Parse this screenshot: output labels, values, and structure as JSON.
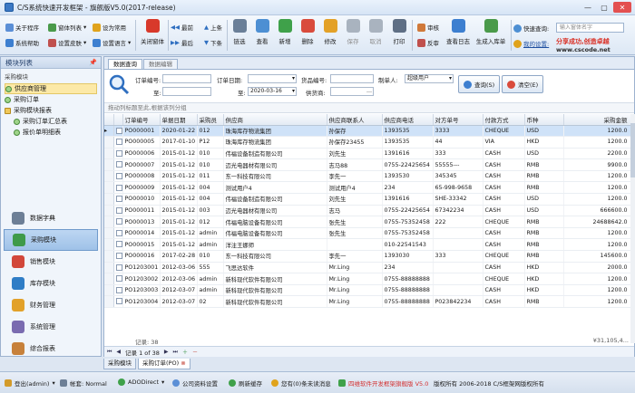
{
  "window": {
    "title": "C/S系统快速开发框架 - 旗舰版V5.0(2017-release)",
    "minimize": "—",
    "maximize": "▢",
    "close": "✕"
  },
  "toolbar": {
    "small_buttons": [
      {
        "label": "关于程序",
        "color": "#5b8fd6"
      },
      {
        "label": "窗体列表",
        "color": "#4a9a4a"
      },
      {
        "label": "设为常用",
        "color": "#e0a31c"
      },
      {
        "label": "系统帮助",
        "color": "#3d7fd0"
      },
      {
        "label": "设置皮肤",
        "color": "#c0504d"
      },
      {
        "label": "设置语言",
        "color": "#3d7fd0"
      }
    ],
    "close_window": "关闭窗体",
    "nav": [
      {
        "label": "最前",
        "arrow": "◀◀"
      },
      {
        "label": "上条",
        "arrow": "▲"
      },
      {
        "label": "最后",
        "arrow": "▶▶"
      },
      {
        "label": "下条",
        "arrow": "▼"
      }
    ],
    "big_buttons": [
      {
        "label": "链选",
        "color": "#6a7f98",
        "enabled": true
      },
      {
        "label": "查看",
        "color": "#4d8fd3",
        "enabled": true
      },
      {
        "label": "新增",
        "color": "#3fa14a",
        "enabled": true
      },
      {
        "label": "删除",
        "color": "#d94b3c",
        "enabled": true
      },
      {
        "label": "修改",
        "color": "#e3a127",
        "enabled": true
      },
      {
        "label": "保存",
        "color": "#a9b3bf",
        "enabled": false
      },
      {
        "label": "取消",
        "color": "#a9b3bf",
        "enabled": false
      },
      {
        "label": "打印",
        "color": "#5f6f85",
        "enabled": true
      },
      {
        "label": "审核",
        "color": "#d0793a",
        "enabled": true
      },
      {
        "label": "反审",
        "color": "#c0504d",
        "enabled": true
      },
      {
        "label": "查看日志",
        "color": "#3d7fd0",
        "enabled": true
      },
      {
        "label": "生成入库单",
        "color": "#4a9a4a",
        "enabled": true
      }
    ],
    "quick_search_label": "快速查询:",
    "search_placeholder": "输入窗体名字",
    "my_settings": "我的设置:",
    "slogan": "分享成功,创造卓越",
    "site": "www.cscode.net"
  },
  "left_panel": {
    "header": "模块列表",
    "pin": "📌",
    "category": "采购模块",
    "nodes": [
      {
        "label": "供应商管理",
        "selected": true,
        "child": false
      },
      {
        "label": "采购订单",
        "selected": false,
        "child": false
      },
      {
        "label": "采购模块报表",
        "selected": false,
        "child": false
      },
      {
        "label": "采购订单汇总表",
        "selected": false,
        "child": true
      },
      {
        "label": "报价单明细表",
        "selected": false,
        "child": true
      }
    ],
    "modules": [
      {
        "label": "数据字典",
        "color": "#6d7f96",
        "selected": false
      },
      {
        "label": "采购模块",
        "color": "#3e9a4a",
        "selected": true
      },
      {
        "label": "销售模块",
        "color": "#d2473a",
        "selected": false
      },
      {
        "label": "库存模块",
        "color": "#2f7dc6",
        "selected": false
      },
      {
        "label": "财务管理",
        "color": "#e2a12a",
        "selected": false
      },
      {
        "label": "系统管理",
        "color": "#7a6bb0",
        "selected": false
      },
      {
        "label": "综合报表",
        "color": "#c7813b",
        "selected": false
      }
    ]
  },
  "main": {
    "tabs": [
      {
        "label": "数据查询",
        "active": true
      },
      {
        "label": "数据编辑",
        "active": false
      }
    ],
    "query": {
      "order_no_label": "订单编号:",
      "order_date_label": "订单日期:",
      "to_label": "至:",
      "date_to": "2020-03-16",
      "goods_no_label": "货品编号:",
      "supplier_no_label": "供货商:",
      "maker_label": "制单人:",
      "maker_value": "超级用户",
      "query_button": "查询(S)",
      "clear_button": "清空(E)"
    },
    "group_hint": "拖动列标题至此,根据该列分组",
    "columns": [
      "订单编号",
      "单据日期",
      "采购员",
      "供应商",
      "供应商联系人",
      "供应商电话",
      "对方单号",
      "付款方式",
      "币种",
      "采购金额"
    ],
    "rows": [
      [
        "PO000001",
        "2020-01-22",
        "012",
        "珠海库存物流集团",
        "孙保存",
        "1393535",
        "3333",
        "CHEQUE",
        "USD",
        "1200.0"
      ],
      [
        "PO000005",
        "2017-01-10",
        "P12",
        "珠海库存物流集团",
        "孙保存23455",
        "1393535",
        "44",
        "VIA",
        "HKD",
        "1200.0"
      ],
      [
        "PO000006",
        "2015-01-12",
        "010",
        "伟福设备制造有限公司",
        "刘先生",
        "1391616",
        "333",
        "CASH",
        "USD",
        "2200.0"
      ],
      [
        "PO000007",
        "2015-01-12",
        "010",
        "迈光电器材有限公司",
        "志马88",
        "0755-22425654",
        "55555---",
        "CASH",
        "RMB",
        "9900.0"
      ],
      [
        "PO000008",
        "2015-01-12",
        "011",
        "东一科技有限公司",
        "李先一",
        "1393530",
        "345345",
        "CASH",
        "RMB",
        "1200.0"
      ],
      [
        "PO000009",
        "2015-01-12",
        "004",
        "测试用户4",
        "测试用户4",
        "234",
        "65-998-9658",
        "CASH",
        "RMB",
        "1200.0"
      ],
      [
        "PO000010",
        "2015-01-12",
        "004",
        "伟福设备制造有限公司",
        "刘先生",
        "1391616",
        "SHE-33342",
        "CASH",
        "USD",
        "1200.0"
      ],
      [
        "PO000011",
        "2015-01-12",
        "003",
        "迈光电器材有限公司",
        "志马",
        "0755-22425654",
        "67342234",
        "CASH",
        "USD",
        "666600.0"
      ],
      [
        "PO000013",
        "2015-01-12",
        "012",
        "伟福电脑设备有限公司",
        "张先生",
        "0755-75352458",
        "222",
        "CHEQUE",
        "RMB",
        "24688642.0"
      ],
      [
        "PO000014",
        "2015-01-12",
        "admin",
        "伟福电脑设备有限公司",
        "张先生",
        "0755-75352458",
        "",
        "CASH",
        "RMB",
        "1200.0"
      ],
      [
        "PO000015",
        "2015-01-12",
        "admin",
        "洋注王娜师",
        "",
        "010-22541543",
        "",
        "CASH",
        "RMB",
        "1200.0"
      ],
      [
        "PO000016",
        "2017-02-28",
        "010",
        "东一科技有限公司",
        "李先一",
        "1393030",
        "333",
        "CHEQUE",
        "RMB",
        "145600.0"
      ],
      [
        "PO1203001",
        "2012-03-06",
        "555",
        "飞思达软件",
        "Mr.Ling",
        "234",
        "",
        "CASH",
        "HKD",
        "2000.0"
      ],
      [
        "PO1203002",
        "2012-03-06",
        "admin",
        "新科现代软件有限公司",
        "Mr.Ling",
        "0755-88888888",
        "",
        "CHEQUE",
        "HKD",
        "1200.0"
      ],
      [
        "PO1203003",
        "2012-03-07",
        "admin",
        "新科现代软件有限公司",
        "Mr.Ling",
        "0755-88888888",
        "",
        "CASH",
        "HKD",
        "1200.0"
      ],
      [
        "PO1203004",
        "2012-03-07",
        "02",
        "新科现代软件有限公司",
        "Mr.Ling",
        "0755-88888888",
        "P023842234",
        "CASH",
        "RMB",
        "1200.0"
      ]
    ],
    "row_count_label": "记录: 38",
    "sum_label": "¥31,105,4...",
    "pager": {
      "record_text": "记录 1 of 38"
    }
  },
  "bottom_tabs": [
    {
      "label": "采购模块",
      "active": false
    },
    {
      "label": "采购订单(PO)",
      "active": true
    }
  ],
  "status": {
    "login": "登出(admin)",
    "account": "帐套: Normal",
    "ado": "ADODirect",
    "company": "公司资料设置",
    "refresh": "刷新缓存",
    "messages": "您有(0)条未读消息",
    "upgrade": "四维软件开发框架旗舰版 V5.0",
    "copyright": "版权所有 2006-2018 C/S框架网版权所有",
    "upgrade_color": "#d32f2f"
  }
}
